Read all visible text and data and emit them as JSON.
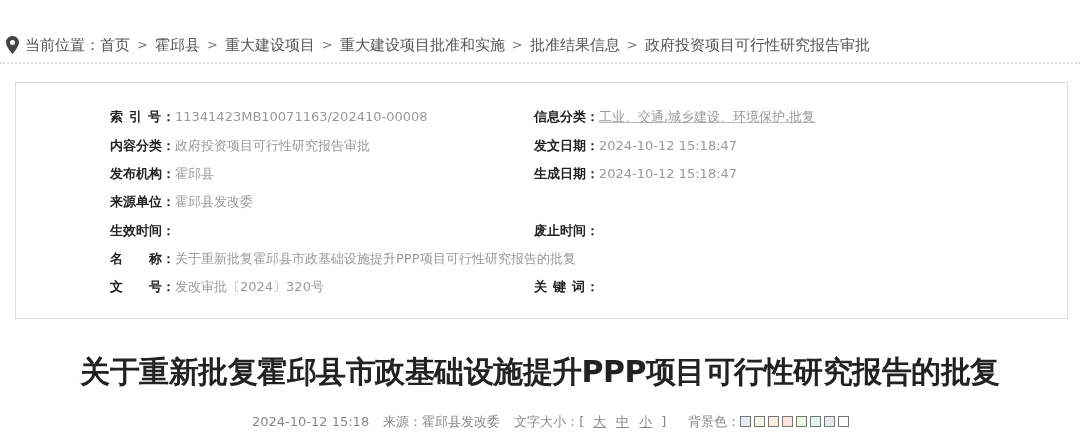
{
  "breadcrumb": {
    "label": "当前位置：",
    "items": [
      "首页",
      "霍邱县",
      "重大建设项目",
      "重大建设项目批准和实施",
      "批准结果信息",
      "政府投资项目可行性研究报告审批"
    ],
    "separator": ">"
  },
  "info_rows": [
    {
      "left": {
        "label": "索 引 号：",
        "value": "11341423MB10071163/202410-00008"
      },
      "right": {
        "label": "信息分类：",
        "value": "工业、交通,城乡建设、环境保护,批复",
        "link": true
      }
    },
    {
      "left": {
        "label": "内容分类：",
        "value": "政府投资项目可行性研究报告审批"
      },
      "right": {
        "label": "发文日期：",
        "value": "2024-10-12 15:18:47"
      }
    },
    {
      "left": {
        "label": "发布机构：",
        "value": "霍邱县"
      },
      "right": {
        "label": "生成日期：",
        "value": "2024-10-12 15:18:47"
      }
    },
    {
      "left": {
        "label": "来源单位：",
        "value": "霍邱县发改委"
      }
    },
    {
      "left": {
        "label": "生效时间："
      },
      "right": {
        "label": "废止时间："
      }
    },
    {
      "left": {
        "label": "名　　称：",
        "value": "关于重新批复霍邱县市政基础设施提升PPP项目可行性研究报告的批复"
      }
    },
    {
      "left": {
        "label": "文　　号：",
        "value": "发改审批〔2024〕320号"
      },
      "right": {
        "label": "关 键 词："
      }
    }
  ],
  "title": "关于重新批复霍邱县市政基础设施提升PPP项目可行性研究报告的批复",
  "meta": {
    "date": "2024-10-12 15:18",
    "source": "来源：霍邱县发改委",
    "font_size_label": "文字大小：",
    "bracket_open": "[",
    "font_sizes": [
      "大",
      "中",
      "小"
    ],
    "bracket_close": "]",
    "background_label": "背景色：",
    "swatches": [
      {
        "color": "#e9ecf3"
      },
      {
        "color": "#f2f6e4"
      },
      {
        "color": "#fcece0"
      },
      {
        "color": "#fde2df"
      },
      {
        "color": "#eef7e1"
      },
      {
        "color": "#def6ef"
      },
      {
        "color": "#e5e6ee"
      },
      {
        "color": "#ffffff"
      }
    ]
  }
}
